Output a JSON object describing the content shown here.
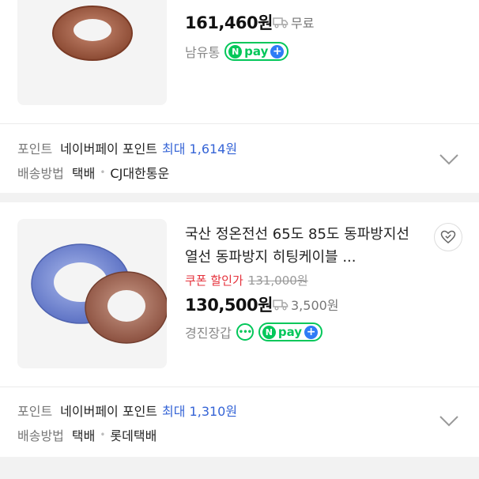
{
  "products": [
    {
      "price": "161,460",
      "currency": "원",
      "shipping": "무료",
      "seller": "남유통",
      "npay_label": "pay",
      "points_label": "포인트",
      "points_value": "네이버페이 포인트",
      "points_max": "최대 1,614원",
      "delivery_label": "배송방법",
      "delivery_type": "택배",
      "courier": "CJ대한통운"
    },
    {
      "title": "국산 정온전선 65도 85도 동파방지선 열선 동파방지 히팅케이블 ...",
      "coupon_label": "쿠폰 할인가",
      "original_price": "131,000원",
      "price": "130,500",
      "currency": "원",
      "shipping": "3,500원",
      "seller": "경진장갑",
      "npay_label": "pay",
      "points_label": "포인트",
      "points_value": "네이버페이 포인트",
      "points_max": "최대 1,310원",
      "delivery_label": "배송방법",
      "delivery_type": "택배",
      "courier": "롯데택배"
    }
  ],
  "icons": {
    "truck": "truck-icon",
    "talk": "talk-icon",
    "chevron": "chevron-down-icon",
    "zzim": "heart-check-icon"
  },
  "colors": {
    "accent_green": "#03c75a",
    "accent_blue": "#3564d6",
    "coupon_red": "#e5323c"
  }
}
